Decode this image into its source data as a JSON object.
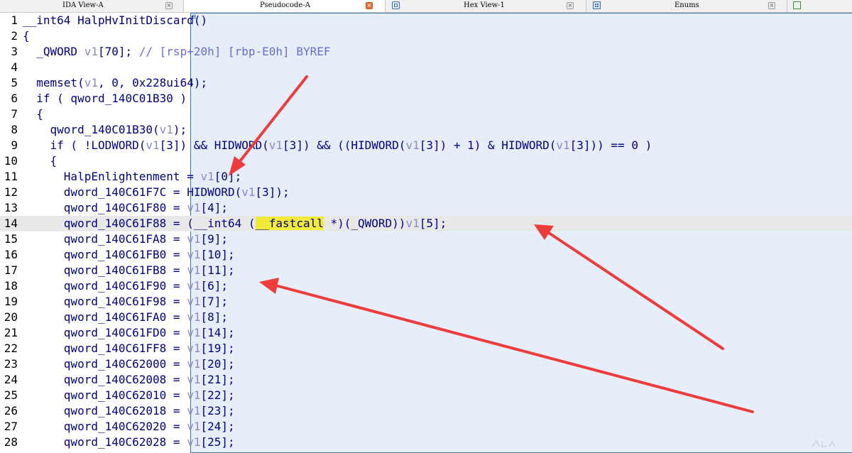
{
  "tabs": [
    {
      "label": "IDA View-A",
      "icon": "ida-view-icon",
      "active": false,
      "close_hot": false
    },
    {
      "label": "Pseudocode-A",
      "icon": "pseudocode-icon",
      "active": true,
      "close_hot": true
    },
    {
      "label": "Hex View-1",
      "icon": "hex-view-icon",
      "active": false,
      "close_hot": false
    },
    {
      "label": "Enums",
      "icon": "enums-icon",
      "active": false,
      "close_hot": false
    }
  ],
  "close_glyph": "×",
  "highlighted_line": 14,
  "lines": [
    {
      "n": "1",
      "parts": [
        {
          "t": "__int64 HalpHvInitDiscard()"
        }
      ]
    },
    {
      "n": "2",
      "parts": [
        {
          "t": "{"
        }
      ]
    },
    {
      "n": "3",
      "parts": [
        {
          "t": "  _QWORD "
        },
        {
          "t": "v1",
          "c": "v"
        },
        {
          "t": "[70]; "
        },
        {
          "t": "// [rsp+20h] [rbp-E0h] BYREF",
          "c": "c"
        }
      ]
    },
    {
      "n": "4",
      "parts": [
        {
          "t": ""
        }
      ]
    },
    {
      "n": "5",
      "parts": [
        {
          "t": "  memset("
        },
        {
          "t": "v1",
          "c": "v"
        },
        {
          "t": ", 0, 0x228ui64);"
        }
      ]
    },
    {
      "n": "6",
      "parts": [
        {
          "t": "  if ( qword_140C01B30 )"
        }
      ]
    },
    {
      "n": "7",
      "parts": [
        {
          "t": "  {"
        }
      ]
    },
    {
      "n": "8",
      "parts": [
        {
          "t": "    qword_140C01B30("
        },
        {
          "t": "v1",
          "c": "v"
        },
        {
          "t": ");"
        }
      ]
    },
    {
      "n": "9",
      "parts": [
        {
          "t": "    if ( !LODWORD("
        },
        {
          "t": "v1",
          "c": "v"
        },
        {
          "t": "[3]) && HIDWORD("
        },
        {
          "t": "v1",
          "c": "v"
        },
        {
          "t": "[3]) && ((HIDWORD("
        },
        {
          "t": "v1",
          "c": "v"
        },
        {
          "t": "[3]) + 1) & HIDWORD("
        },
        {
          "t": "v1",
          "c": "v"
        },
        {
          "t": "[3])) == 0 )"
        }
      ]
    },
    {
      "n": "10",
      "parts": [
        {
          "t": "    {"
        }
      ]
    },
    {
      "n": "11",
      "parts": [
        {
          "t": "      HalpEnlightenment = "
        },
        {
          "t": "v1",
          "c": "v"
        },
        {
          "t": "[0];"
        }
      ]
    },
    {
      "n": "12",
      "parts": [
        {
          "t": "      dword_140C61F7C = HIDWORD("
        },
        {
          "t": "v1",
          "c": "v"
        },
        {
          "t": "[3]);"
        }
      ]
    },
    {
      "n": "13",
      "parts": [
        {
          "t": "      qword_140C61F80 = "
        },
        {
          "t": "v1",
          "c": "v"
        },
        {
          "t": "[4];"
        }
      ]
    },
    {
      "n": "14",
      "parts": [
        {
          "t": "      qword_140C61F88 = (__int64 ("
        },
        {
          "t": "__fastcall",
          "c": "hlword"
        },
        {
          "t": " *)(_QWORD))"
        },
        {
          "t": "v1",
          "c": "v"
        },
        {
          "t": "[5];"
        }
      ]
    },
    {
      "n": "15",
      "parts": [
        {
          "t": "      qword_140C61FA8 = "
        },
        {
          "t": "v1",
          "c": "v"
        },
        {
          "t": "[9];"
        }
      ]
    },
    {
      "n": "16",
      "parts": [
        {
          "t": "      qword_140C61FB0 = "
        },
        {
          "t": "v1",
          "c": "v"
        },
        {
          "t": "[10];"
        }
      ]
    },
    {
      "n": "17",
      "parts": [
        {
          "t": "      qword_140C61FB8 = "
        },
        {
          "t": "v1",
          "c": "v"
        },
        {
          "t": "[11];"
        }
      ]
    },
    {
      "n": "18",
      "parts": [
        {
          "t": "      qword_140C61F90 = "
        },
        {
          "t": "v1",
          "c": "v"
        },
        {
          "t": "[6];"
        }
      ]
    },
    {
      "n": "19",
      "parts": [
        {
          "t": "      qword_140C61F98 = "
        },
        {
          "t": "v1",
          "c": "v"
        },
        {
          "t": "[7];"
        }
      ]
    },
    {
      "n": "20",
      "parts": [
        {
          "t": "      qword_140C61FA0 = "
        },
        {
          "t": "v1",
          "c": "v"
        },
        {
          "t": "[8];"
        }
      ]
    },
    {
      "n": "21",
      "parts": [
        {
          "t": "      qword_140C61FD0 = "
        },
        {
          "t": "v1",
          "c": "v"
        },
        {
          "t": "[14];"
        }
      ]
    },
    {
      "n": "22",
      "parts": [
        {
          "t": "      qword_140C61FF8 = "
        },
        {
          "t": "v1",
          "c": "v"
        },
        {
          "t": "[19];"
        }
      ]
    },
    {
      "n": "23",
      "parts": [
        {
          "t": "      qword_140C62000 = "
        },
        {
          "t": "v1",
          "c": "v"
        },
        {
          "t": "[20];"
        }
      ]
    },
    {
      "n": "24",
      "parts": [
        {
          "t": "      qword_140C62008 = "
        },
        {
          "t": "v1",
          "c": "v"
        },
        {
          "t": "[21];"
        }
      ]
    },
    {
      "n": "25",
      "parts": [
        {
          "t": "      qword_140C62010 = "
        },
        {
          "t": "v1",
          "c": "v"
        },
        {
          "t": "[22];"
        }
      ]
    },
    {
      "n": "26",
      "parts": [
        {
          "t": "      qword_140C62018 = "
        },
        {
          "t": "v1",
          "c": "v"
        },
        {
          "t": "[23];"
        }
      ]
    },
    {
      "n": "27",
      "parts": [
        {
          "t": "      qword_140C62020 = "
        },
        {
          "t": "v1",
          "c": "v"
        },
        {
          "t": "[24];"
        }
      ]
    },
    {
      "n": "28",
      "parts": [
        {
          "t": "      qword_140C62028 = "
        },
        {
          "t": "v1",
          "c": "v"
        },
        {
          "t": "[25];"
        }
      ]
    }
  ],
  "colors": {
    "code_text": "#000080",
    "variable": "#8a8ac8",
    "comment": "#6b6bd0",
    "line_highlight": "#e8e8e8",
    "word_highlight": "#f2ea3a",
    "annotation_arrow": "#ee3b3b"
  },
  "annotations": {
    "arrow_count": 3,
    "targets": [
      "v1[0] on line 11",
      "v1[5] on line 14",
      "v1[6] on line 18"
    ]
  }
}
